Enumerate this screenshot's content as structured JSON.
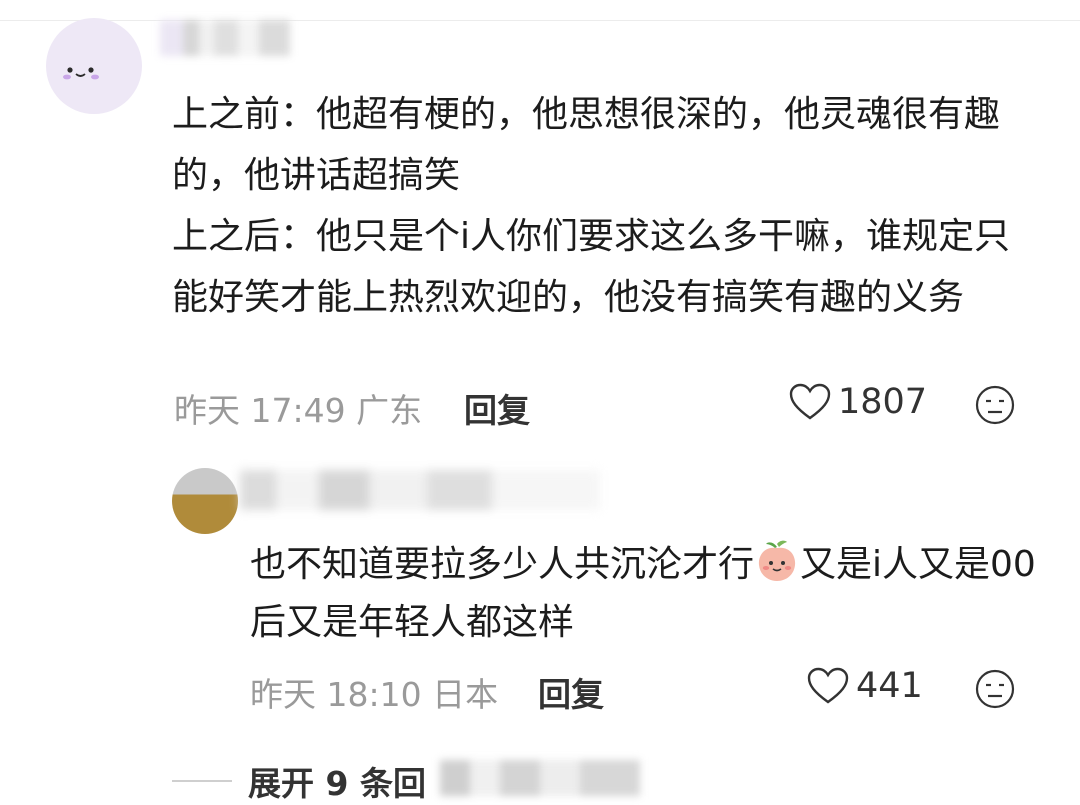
{
  "comment": {
    "text_lines": [
      "上之前：他超有梗的，他思想很深的，他灵魂很有趣的，他讲话超搞笑",
      "上之后：他只是个i人你们要求这么多干嘛，谁规定只能好笑才能上热烈欢迎的，他没有搞笑有趣的义务"
    ],
    "time": "昨天 17:49",
    "location": "广东",
    "reply_label": "回复",
    "likes": "1807"
  },
  "reply": {
    "text_part1": "也不知道要拉多少人共沉沦才行",
    "text_part2": "又是i人又是00后又是年轻人都这样",
    "time": "昨天 18:10",
    "location": "日本",
    "reply_label": "回复",
    "likes": "441"
  },
  "expand_label": "展开 9 条回",
  "icons": [
    "heart-icon",
    "dislike-face-icon",
    "peach-emoji-icon"
  ],
  "colors": {
    "meta_text": "#9a9a9a",
    "body_text": "#1c1c1c"
  }
}
